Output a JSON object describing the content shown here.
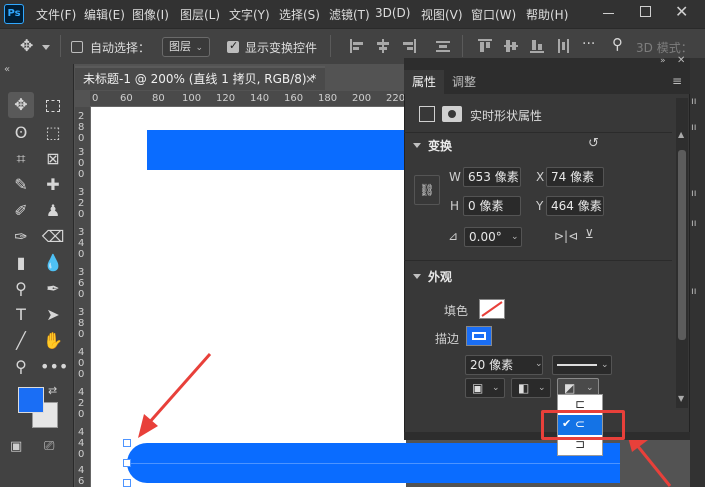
{
  "app": {
    "logo": "Ps"
  },
  "menu": [
    "文件(F)",
    "编辑(E)",
    "图像(I)",
    "图层(L)",
    "文字(Y)",
    "选择(S)",
    "滤镜(T)",
    "3D(D)",
    "视图(V)",
    "窗口(W)",
    "帮助(H)"
  ],
  "options_bar": {
    "auto_select_label": "自动选择：",
    "auto_select_checked": false,
    "auto_select_target": "图层",
    "show_transform_label": "显示变换控件",
    "show_transform_checked": true,
    "mode_3d": "3D 模式："
  },
  "document": {
    "tab_title": "未标题-1 @ 200% (直线 1 拷贝, RGB/8) *",
    "close": "×",
    "ruler_h": [
      "0",
      "60",
      "80",
      "100",
      "120",
      "140",
      "160",
      "180",
      "200",
      "220"
    ],
    "ruler_v": [
      "2",
      "8",
      "0",
      "3",
      "0",
      "0",
      "3",
      "2",
      "0",
      "3",
      "4",
      "0",
      "3",
      "6",
      "0",
      "3",
      "8",
      "0",
      "4",
      "0",
      "0",
      "4",
      "2",
      "0",
      "4",
      "4",
      "0",
      "4",
      "6",
      "0"
    ]
  },
  "panel": {
    "tabs": [
      "属性",
      "调整"
    ],
    "active_tab": "属性",
    "subtitle": "实时形状属性",
    "transform": {
      "title": "变换",
      "w_label": "W",
      "w_value": "653 像素",
      "x_label": "X",
      "x_value": "74 像素",
      "h_label": "H",
      "h_value": "0 像素",
      "y_label": "Y",
      "y_value": "464 像素",
      "angle_value": "0.00°"
    },
    "appearance": {
      "title": "外观",
      "fill_label": "填色",
      "stroke_label": "描边",
      "stroke_width": "20 像素"
    }
  },
  "stroke_cap_options": {
    "selected_index": 1,
    "items": [
      "butt-cap",
      "round-cap",
      "square-cap"
    ],
    "check": "✔"
  },
  "colors": {
    "accent_blue": "#0a6cff",
    "highlight_red": "#e8403a",
    "foreground": "#1a6ef5",
    "background": "#e6e6e6"
  }
}
